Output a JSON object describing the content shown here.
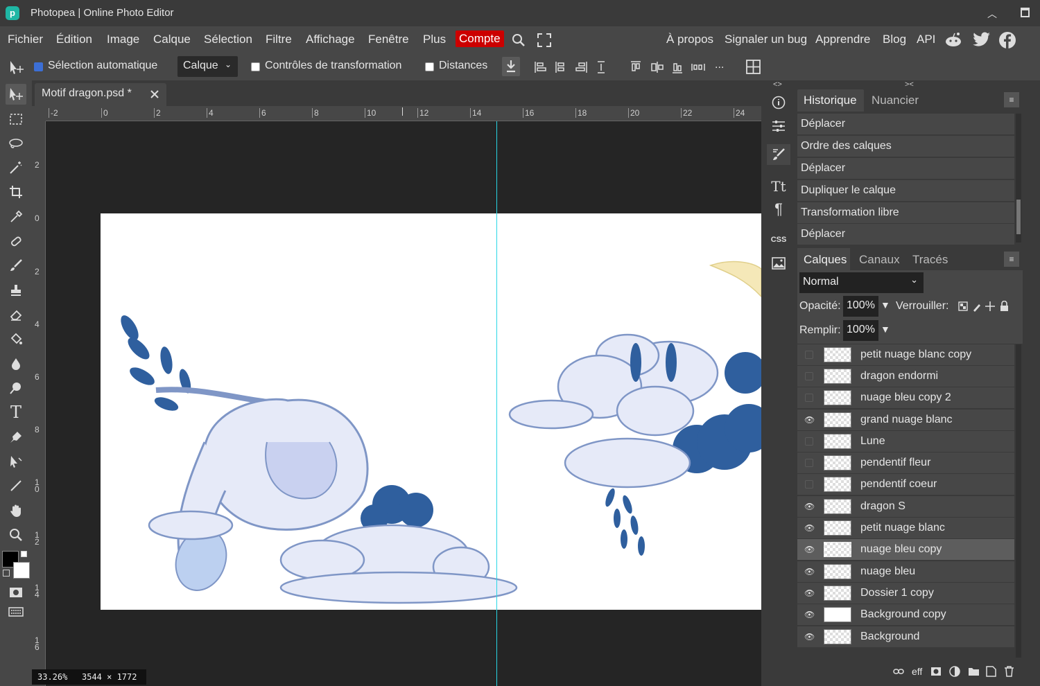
{
  "window": {
    "title": "Photopea | Online Photo Editor",
    "logo": "p"
  },
  "menu": {
    "left": [
      "Fichier",
      "Édition",
      "Image",
      "Calque",
      "Sélection",
      "Filtre",
      "Affichage",
      "Fenêtre",
      "Plus"
    ],
    "account": "Compte",
    "right": [
      "À propos",
      "Signaler un bug",
      "Apprendre",
      "Blog",
      "API"
    ]
  },
  "options": {
    "auto_select_label": "Sélection automatique",
    "auto_select_checked": true,
    "target_value": "Calque",
    "transform_controls_label": "Contrôles de transformation",
    "distances_label": "Distances",
    "more": "..."
  },
  "document": {
    "tab_title": "Motif dragon.psd *",
    "zoom": "33.26%",
    "size": "3544 × 1772"
  },
  "ruler": {
    "h_labels": [
      "-2",
      "0",
      "2",
      "4",
      "6",
      "8",
      "10",
      "12",
      "14",
      "16",
      "18",
      "20",
      "22",
      "24"
    ],
    "v_labels": [
      "2",
      "0",
      "2",
      "4",
      "6",
      "8",
      "1 0",
      "1 2",
      "1 4",
      "1 6"
    ]
  },
  "history": {
    "tabs": [
      "Historique",
      "Nuancier"
    ],
    "items": [
      "Déplacer",
      "Ordre des calques",
      "Déplacer",
      "Dupliquer le calque",
      "Transformation libre",
      "Déplacer"
    ]
  },
  "layers_panel": {
    "tabs": [
      "Calques",
      "Canaux",
      "Tracés"
    ],
    "blend_mode": "Normal",
    "opacity_label": "Opacité:",
    "opacity_value": "100%",
    "lock_label": "Verrouiller:",
    "fill_label": "Remplir:",
    "fill_value": "100%",
    "layers": [
      {
        "name": "petit nuage blanc copy",
        "visible": false,
        "selected": false
      },
      {
        "name": "dragon endormi",
        "visible": false,
        "selected": false
      },
      {
        "name": "nuage bleu copy 2",
        "visible": false,
        "selected": false
      },
      {
        "name": "grand nuage blanc",
        "visible": true,
        "selected": false
      },
      {
        "name": "Lune",
        "visible": false,
        "selected": false
      },
      {
        "name": "pendentif fleur",
        "visible": false,
        "selected": false
      },
      {
        "name": "pendentif coeur",
        "visible": false,
        "selected": false
      },
      {
        "name": "dragon S",
        "visible": true,
        "selected": false
      },
      {
        "name": "petit nuage blanc",
        "visible": true,
        "selected": false
      },
      {
        "name": "nuage bleu copy",
        "visible": true,
        "selected": true
      },
      {
        "name": "nuage bleu",
        "visible": true,
        "selected": false
      },
      {
        "name": "Dossier 1 copy",
        "visible": true,
        "selected": false
      },
      {
        "name": "Background copy",
        "visible": true,
        "selected": false
      },
      {
        "name": "Background",
        "visible": true,
        "selected": false
      }
    ],
    "footer_eff": "eff"
  },
  "icon_column": {
    "css_label": "CSS"
  },
  "colors": {
    "accent": "#c00000",
    "guide": "#29d6e6",
    "dragon_blue": "#2f5f9e",
    "cloud": "#e6eaf8"
  }
}
